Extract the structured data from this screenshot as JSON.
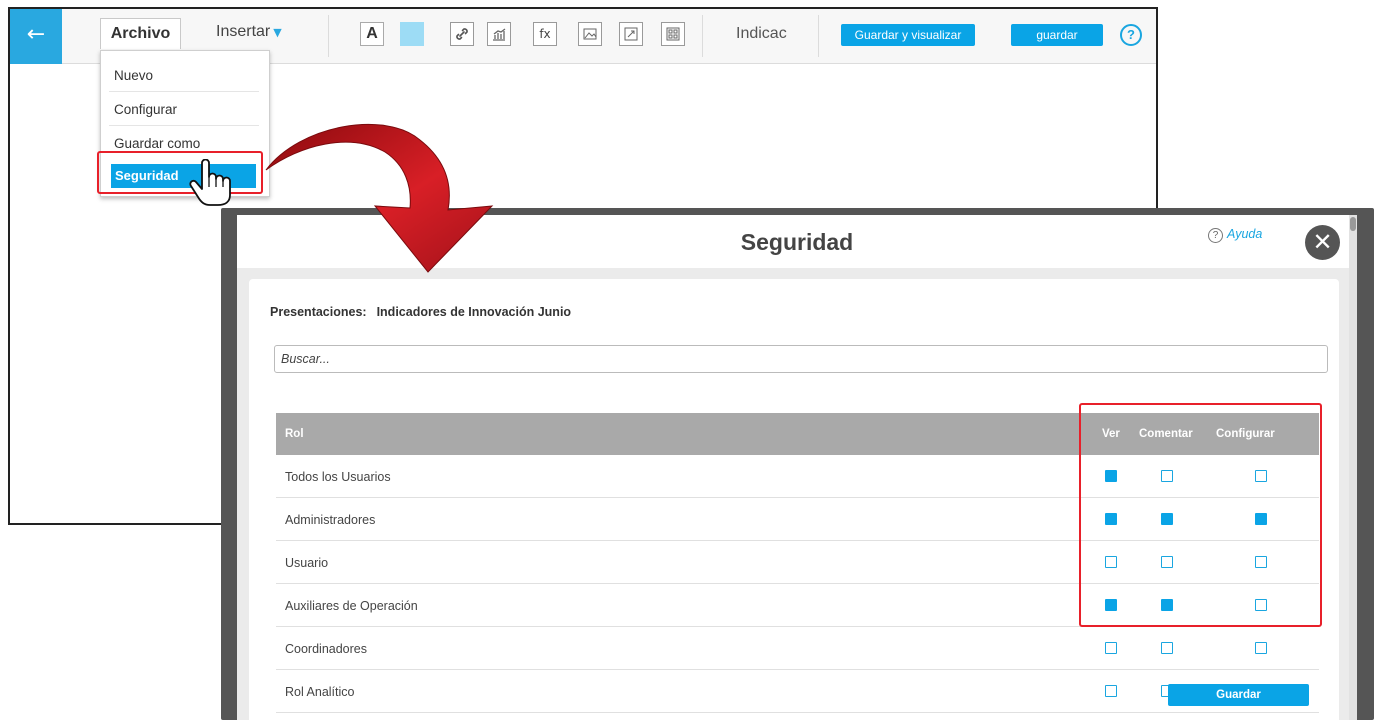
{
  "editor": {
    "back_icon": "arrow-left-icon",
    "menu_archivo": "Archivo",
    "menu_insertar": "Insertar",
    "toolbar_tools": [
      "text-icon",
      "color-swatch-icon",
      "link-icon",
      "chart-icon",
      "function-icon",
      "image-icon",
      "resize-icon",
      "widget-grid-icon"
    ],
    "tool_text_label": "A",
    "tool_function_label": "fx",
    "doc_name": "Indicac",
    "save_view_label": "Guardar y visualizar",
    "save_label": "guardar",
    "help_label": "?",
    "archivo_dropdown": [
      "Nuevo",
      "Configurar",
      "Guardar como",
      "Seguridad"
    ]
  },
  "modal": {
    "title": "Seguridad",
    "help_link": "Ayuda",
    "close_icon": "close-icon",
    "presentaciones_label": "Presentaciones:",
    "presentaciones_value": "Indicadores de Innovación Junio",
    "search_placeholder": "Buscar...",
    "table": {
      "columns": [
        "Rol",
        "Ver",
        "Comentar",
        "Configurar"
      ],
      "rows": [
        {
          "role": "Todos los Usuarios",
          "ver": true,
          "comentar": false,
          "configurar": false
        },
        {
          "role": "Administradores",
          "ver": true,
          "comentar": true,
          "configurar": true
        },
        {
          "role": "Usuario",
          "ver": false,
          "comentar": false,
          "configurar": false
        },
        {
          "role": "Auxiliares de Operación",
          "ver": true,
          "comentar": true,
          "configurar": false
        },
        {
          "role": "Coordinadores",
          "ver": false,
          "comentar": false,
          "configurar": false
        },
        {
          "role": "Rol Analítico",
          "ver": false,
          "comentar": false,
          "configurar": null
        }
      ]
    },
    "save_button": "Guardar"
  },
  "colors": {
    "accent": "#0aa4e6",
    "highlight": "#e8202a",
    "arrow": "#c4161c"
  }
}
